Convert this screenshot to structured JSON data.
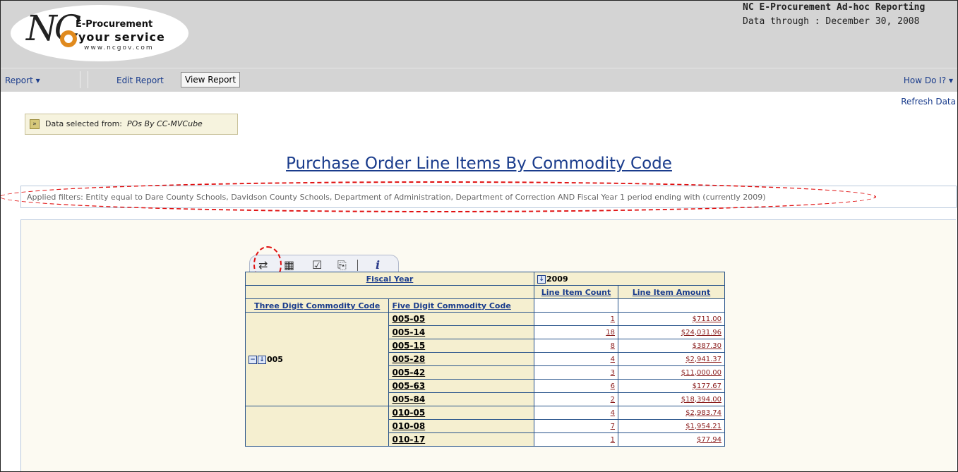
{
  "header": {
    "logo": {
      "line1": "E-Procurement",
      "line2": "your service",
      "line3": "www.ncgov.com"
    },
    "app_title": "NC E-Procurement Ad-hoc Reporting",
    "data_through": "Data through : December 30, 2008"
  },
  "nav": {
    "report": "Report ▾",
    "edit_report": "Edit Report",
    "view_report": "View Report",
    "how_do_i": "How Do I? ▾"
  },
  "refresh": "Refresh Data",
  "source": {
    "label": "Data selected from:",
    "value": "POs By CC-MVCube"
  },
  "report_title": "Purchase Order Line Items By Commodity Code",
  "filters": "Applied filters:  Entity equal to Dare County Schools, Davidson County Schools, Department of Administration, Department of Correction  AND  Fiscal Year 1 period ending with (currently 2009)",
  "toolbar": {
    "icons": [
      "pivot-icon",
      "options-icon",
      "check-icon",
      "export-icon",
      "info-icon"
    ],
    "info_glyph": "i"
  },
  "pivot": {
    "fiscal_year_header": "Fiscal Year",
    "year": "2009",
    "col_count": "Line Item Count",
    "col_amount": "Line Item Amount",
    "row_h1": "Three Digit Commodity Code",
    "row_h2": "Five Digit Commodity Code",
    "group1": "005",
    "rows": [
      {
        "code": "005-05",
        "count": "1",
        "amount": "$711.00"
      },
      {
        "code": "005-14",
        "count": "18",
        "amount": "$24,031.96"
      },
      {
        "code": "005-15",
        "count": "8",
        "amount": "$387.30"
      },
      {
        "code": "005-28",
        "count": "4",
        "amount": "$2,941.37"
      },
      {
        "code": "005-42",
        "count": "3",
        "amount": "$11,000.00"
      },
      {
        "code": "005-63",
        "count": "6",
        "amount": "$177.67"
      },
      {
        "code": "005-84",
        "count": "2",
        "amount": "$18,394.00"
      },
      {
        "code": "010-05",
        "count": "4",
        "amount": "$2,983.74"
      },
      {
        "code": "010-08",
        "count": "7",
        "amount": "$1,954.21"
      },
      {
        "code": "010-17",
        "count": "1",
        "amount": "$77.94"
      }
    ]
  }
}
